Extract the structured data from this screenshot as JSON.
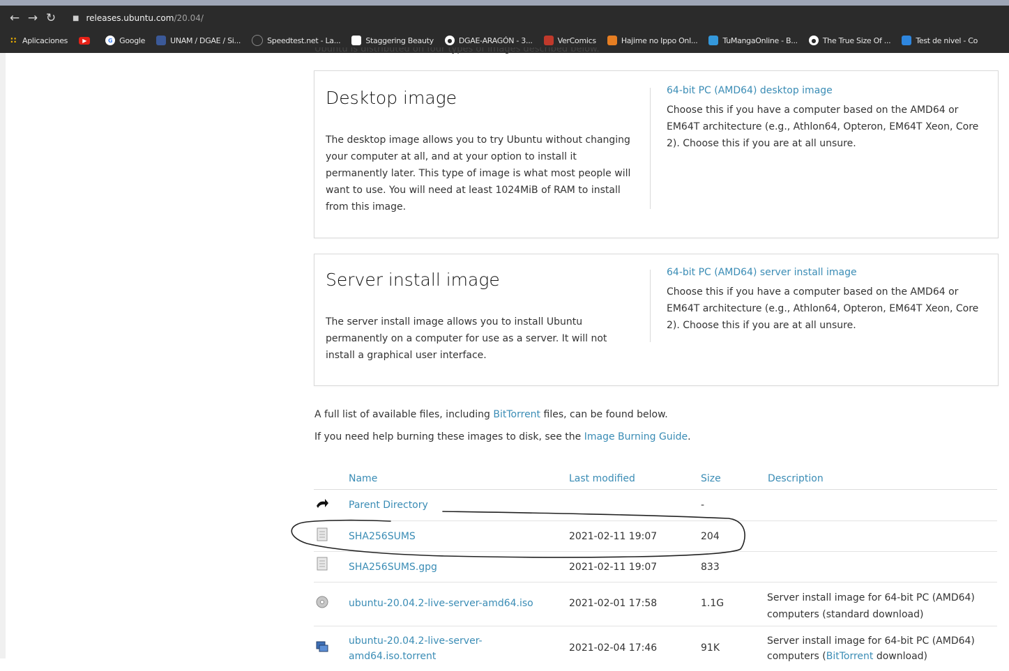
{
  "browser": {
    "url_host": "releases.ubuntu.com",
    "url_path": "/20.04/",
    "bookmarks": [
      {
        "label": "Aplicaciones",
        "icon": "apps-grid-icon",
        "color": "#f4b400"
      },
      {
        "label": "",
        "icon": "youtube-icon",
        "color": "#e62117"
      },
      {
        "label": "Google",
        "icon": "google-icon",
        "color": "#ffffff"
      },
      {
        "label": "UNAM / DGAE / Si...",
        "icon": "unam-icon",
        "color": "#3b5998"
      },
      {
        "label": "Speedtest.net - La...",
        "icon": "speedtest-icon",
        "color": "#444444"
      },
      {
        "label": "Staggering Beauty",
        "icon": "page-icon",
        "color": "#ffffff"
      },
      {
        "label": "DGAE-ARAGÓN - 3...",
        "icon": "globe-icon",
        "color": "#ffffff"
      },
      {
        "label": "VerComics",
        "icon": "vercomics-icon",
        "color": "#c0392b"
      },
      {
        "label": "Hajime no Ippo Onl...",
        "icon": "ao-icon",
        "color": "#e67e22"
      },
      {
        "label": "TuMangaOnline - B...",
        "icon": "tmo-icon",
        "color": "#3498db"
      },
      {
        "label": "The True Size Of ...",
        "icon": "globe-icon",
        "color": "#ffffff"
      },
      {
        "label": "Test de nivel - Co",
        "icon": "test-icon",
        "color": "#2e86de"
      }
    ]
  },
  "page": {
    "cutoff_text": "Ubuntu is distributed on four types of images described below.",
    "desktop": {
      "title": "Desktop image",
      "description": "The desktop image allows you to try Ubuntu without changing your computer at all, and at your option to install it permanently later. This type of image is what most people will want to use. You will need at least 1024MiB of RAM to install from this image.",
      "link": "64-bit PC (AMD64) desktop image",
      "note": "Choose this if you have a computer based on the AMD64 or EM64T architecture (e.g., Athlon64, Opteron, EM64T Xeon, Core 2). Choose this if you are at all unsure."
    },
    "server": {
      "title": "Server install image",
      "description": "The server install image allows you to install Ubuntu permanently on a computer for use as a server. It will not install a graphical user interface.",
      "link": "64-bit PC (AMD64) server install image",
      "note": "Choose this if you have a computer based on the AMD64 or EM64T architecture (e.g., Athlon64, Opteron, EM64T Xeon, Core 2). Choose this if you are at all unsure."
    },
    "info1_pre": "A full list of available files, including ",
    "info1_link": "BitTorrent",
    "info1_post": " files, can be found below.",
    "info2_pre": "If you need help burning these images to disk, see the ",
    "info2_link": "Image Burning Guide",
    "info2_post": "."
  },
  "table": {
    "headers": {
      "name": "Name",
      "modified": "Last modified",
      "size": "Size",
      "description": "Description"
    },
    "rows": [
      {
        "name": "Parent Directory",
        "modified": "",
        "size": "-",
        "desc1": "",
        "desc2_pre": "",
        "desc2_link": "",
        "desc2_post": "",
        "icon": "back-arrow-icon"
      },
      {
        "name": "SHA256SUMS",
        "modified": "2021-02-11 19:07",
        "size": "204",
        "desc1": "",
        "desc2_pre": "",
        "desc2_link": "",
        "desc2_post": "",
        "icon": "text-file-icon"
      },
      {
        "name": "SHA256SUMS.gpg",
        "modified": "2021-02-11 19:07",
        "size": "833",
        "desc1": "",
        "desc2_pre": "",
        "desc2_link": "",
        "desc2_post": "",
        "icon": "text-file-icon"
      },
      {
        "name": "ubuntu-20.04.2-live-server-amd64.iso",
        "modified": "2021-02-01 17:58",
        "size": "1.1G",
        "desc1": "Server install image for 64-bit PC (AMD64)",
        "desc2_pre": "computers (standard download)",
        "desc2_link": "",
        "desc2_post": "",
        "icon": "disc-icon"
      },
      {
        "name": "ubuntu-20.04.2-live-server-amd64.iso.torrent",
        "name_line1": "ubuntu-20.04.2-live-server-",
        "name_line2": "amd64.iso.torrent",
        "modified": "2021-02-04 17:46",
        "size": "91K",
        "desc1": "Server install image for 64-bit PC (AMD64)",
        "desc2_pre": "computers (",
        "desc2_link": "BitTorrent",
        "desc2_post": " download)",
        "icon": "torrent-file-icon"
      }
    ]
  }
}
